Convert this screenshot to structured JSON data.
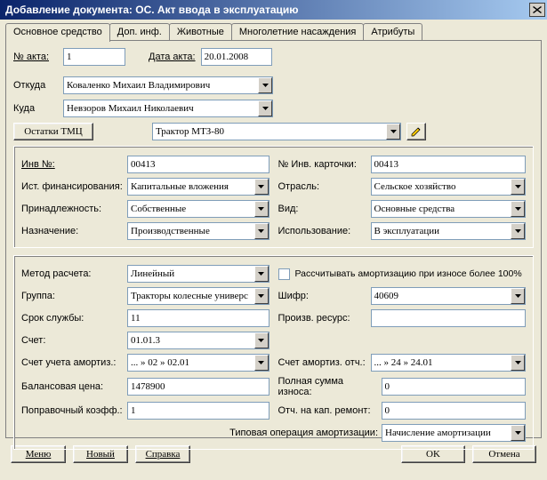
{
  "title": "Добавление документа: ОС. Акт ввода в эксплуатацию",
  "tabs": [
    "Основное средство",
    "Доп. инф.",
    "Животные",
    "Многолетние насаждения",
    "Атрибуты"
  ],
  "header": {
    "act_no_label": "№ акта:",
    "act_no": "1",
    "date_label": "Дата акта:",
    "date": "20.01.2008",
    "from_label": "Откуда",
    "from": "Коваленко  Михаил  Владимирович",
    "to_label": "Куда",
    "to": "Невзоров   Михаил   Николаевич",
    "stock_btn": "Остатки ТМЦ",
    "item": "Трактор МТЗ-80"
  },
  "g1": {
    "inv_no_label": "Инв №:",
    "inv_no": "00413",
    "card_no_label": "№ Инв. карточки:",
    "card_no": "00413",
    "fin_label": "Ист. финансирования:",
    "fin": "Капитальные вложения",
    "industry_label": "Отрасль:",
    "industry": "Сельское хозяйство",
    "own_label": "Принадлежность:",
    "own": "Собственные",
    "kind_label": "Вид:",
    "kind": "Основные средства",
    "purpose_label": "Назначение:",
    "purpose": "Производственные",
    "use_label": "Использование:",
    "use": "В эксплуатации"
  },
  "g2": {
    "method_label": "Метод расчета:",
    "method": "Линейный",
    "chk_label": "Рассчитывать амортизацию при износе более 100%",
    "group_label": "Группа:",
    "group": "Тракторы колесные универс",
    "code_label": "Шифр:",
    "code": "40609",
    "life_label": "Срок службы:",
    "life": "11",
    "res_label": "Произв. ресурс:",
    "res": "",
    "acct_label": "Счет:",
    "acct": "01.01.3",
    "amort_acct_label": "Счет учета амортиз.:",
    "amort_acct": "... » 02 » 02.01",
    "amort_ded_label": "Счет амортиз. отч.:",
    "amort_ded": "... » 24 » 24.01",
    "bal_label": "Балансовая цена:",
    "bal": "1478900",
    "wear_label": "Полная сумма износа:",
    "wear": "0",
    "coef_label": "Поправочный коэфф.:",
    "coef": "1",
    "kapr_label": "Отч. на кап. ремонт:",
    "kapr": "0",
    "typop_label": "Типовая операция амортизации:",
    "typop": "Начисление амортизации"
  },
  "footer": {
    "menu": "Меню",
    "new": "Новый",
    "help": "Справка",
    "ok": "OK",
    "cancel": "Отмена"
  }
}
